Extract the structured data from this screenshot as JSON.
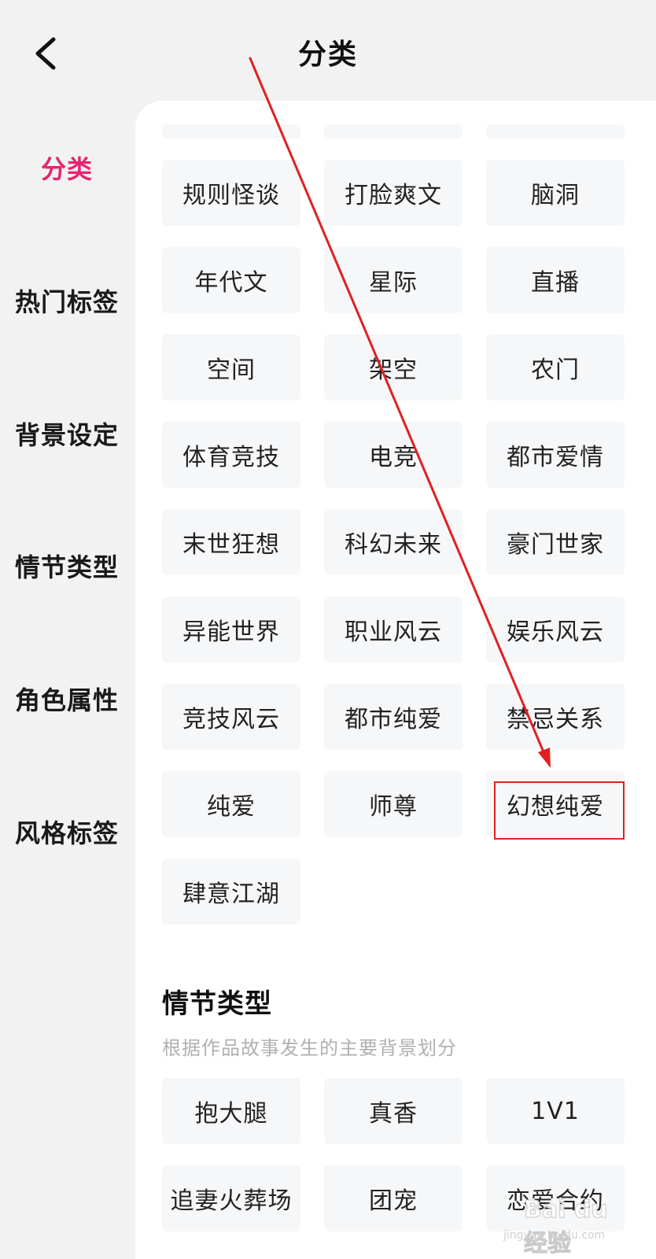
{
  "header": {
    "title": "分类",
    "back_icon": "chevron-left-icon"
  },
  "sidebar": {
    "items": [
      {
        "label": "分类",
        "active": true
      },
      {
        "label": "热门标签",
        "active": false
      },
      {
        "label": "背景设定",
        "active": false
      },
      {
        "label": "情节类型",
        "active": false
      },
      {
        "label": "角色属性",
        "active": false
      },
      {
        "label": "风格标签",
        "active": false
      }
    ],
    "active_color": "#e8246f"
  },
  "categories": {
    "tags": [
      "规则怪谈",
      "打脸爽文",
      "脑洞",
      "年代文",
      "星际",
      "直播",
      "空间",
      "架空",
      "农门",
      "体育竞技",
      "电竞",
      "都市爱情",
      "末世狂想",
      "科幻未来",
      "豪门世家",
      "异能世界",
      "职业风云",
      "娱乐风云",
      "竞技风云",
      "都市纯爱",
      "禁忌关系",
      "纯爱",
      "师尊",
      "幻想纯爱",
      "肆意江湖"
    ],
    "highlighted_tag": "幻想纯爱"
  },
  "plot_section": {
    "title": "情节类型",
    "description": "根据作品故事发生的主要背景划分",
    "tags": [
      "抱大腿",
      "真香",
      "1V1",
      "追妻火葬场",
      "团宠",
      "恋爱合约"
    ]
  },
  "annotation": {
    "color": "#e02020"
  },
  "watermark": {
    "text": "Bai du 经验",
    "url": "jingyan.baidu.com"
  }
}
